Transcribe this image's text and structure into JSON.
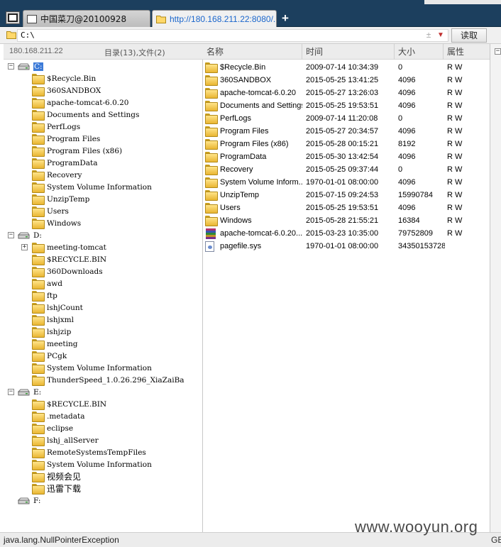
{
  "tabs": [
    {
      "label": "中国菜刀@20100928",
      "active": false
    },
    {
      "label": "http://180.168.211.22:8080/...",
      "active": true
    }
  ],
  "tab_add_label": "+",
  "address": {
    "value": "C:\\",
    "dropdown_dash": "±",
    "read_button": "读取"
  },
  "left": {
    "ip": "180.168.211.22",
    "stats": "目录(13),文件(2)"
  },
  "tree": [
    {
      "label": "C:",
      "kind": "drive",
      "selected": true,
      "expander": "−",
      "children": [
        "$Recycle.Bin",
        "360SANDBOX",
        "apache-tomcat-6.0.20",
        "Documents and Settings",
        "PerfLogs",
        "Program Files",
        "Program Files (x86)",
        "ProgramData",
        "Recovery",
        "System Volume Information",
        "UnzipTemp",
        "Users",
        "Windows"
      ]
    },
    {
      "label": "D:",
      "kind": "drive",
      "selected": false,
      "expander": "−",
      "children": [
        "meeting-tomcat",
        "$RECYCLE.BIN",
        "360Downloads",
        "awd",
        "ftp",
        "lshjCount",
        "lshjxml",
        "lshjzip",
        "meeting",
        "PCgk",
        "System Volume Information",
        "ThunderSpeed_1.0.26.296_XiaZaiBa"
      ],
      "expandable_child": "meeting-tomcat",
      "child_expander": "+"
    },
    {
      "label": "E:",
      "kind": "drive",
      "selected": false,
      "expander": "−",
      "children": [
        "$RECYCLE.BIN",
        ".metadata",
        "eclipse",
        "lshj_allServer",
        "RemoteSystemsTempFiles",
        "System Volume Information",
        "视频会见",
        "迅雷下载"
      ]
    },
    {
      "label": "F:",
      "kind": "drive",
      "selected": false,
      "children": []
    }
  ],
  "columns": {
    "name": "名称",
    "time": "时间",
    "size": "大小",
    "attr": "属性"
  },
  "files": [
    {
      "name": "$Recycle.Bin",
      "time": "2009-07-14 10:34:39",
      "size": "0",
      "attr": "R W",
      "icon": "folder-icon"
    },
    {
      "name": "360SANDBOX",
      "time": "2015-05-25 13:41:25",
      "size": "4096",
      "attr": "R W",
      "icon": "folder-icon"
    },
    {
      "name": "apache-tomcat-6.0.20",
      "time": "2015-05-27 13:26:03",
      "size": "4096",
      "attr": "R W",
      "icon": "folder-icon"
    },
    {
      "name": "Documents and Settings",
      "time": "2015-05-25 19:53:51",
      "size": "4096",
      "attr": "R W",
      "icon": "folder-icon"
    },
    {
      "name": "PerfLogs",
      "time": "2009-07-14 11:20:08",
      "size": "0",
      "attr": "R W",
      "icon": "folder-icon"
    },
    {
      "name": "Program Files",
      "time": "2015-05-27 20:34:57",
      "size": "4096",
      "attr": "R W",
      "icon": "folder-icon"
    },
    {
      "name": "Program Files (x86)",
      "time": "2015-05-28 00:15:21",
      "size": "8192",
      "attr": "R W",
      "icon": "folder-icon"
    },
    {
      "name": "ProgramData",
      "time": "2015-05-30 13:42:54",
      "size": "4096",
      "attr": "R W",
      "icon": "folder-icon"
    },
    {
      "name": "Recovery",
      "time": "2015-05-25 09:37:44",
      "size": "0",
      "attr": "R W",
      "icon": "folder-icon"
    },
    {
      "name": "System Volume Inform...",
      "time": "1970-01-01 08:00:00",
      "size": "4096",
      "attr": "R W",
      "icon": "folder-icon"
    },
    {
      "name": "UnzipTemp",
      "time": "2015-07-15 09:24:53",
      "size": "15990784",
      "attr": "R W",
      "icon": "folder-icon"
    },
    {
      "name": "Users",
      "time": "2015-05-25 19:53:51",
      "size": "4096",
      "attr": "R W",
      "icon": "folder-icon"
    },
    {
      "name": "Windows",
      "time": "2015-05-28 21:55:21",
      "size": "16384",
      "attr": "R W",
      "icon": "folder-icon"
    },
    {
      "name": "apache-tomcat-6.0.20....",
      "time": "2015-03-23 10:35:00",
      "size": "79752809",
      "attr": "R W",
      "icon": "archive-icon"
    },
    {
      "name": "pagefile.sys",
      "time": "1970-01-01 08:00:00",
      "size": "34350153728",
      "attr": "",
      "icon": "system-file-icon"
    }
  ],
  "rightstrip_expander": "−",
  "status": {
    "text": "java.lang.NullPointerException",
    "right": "GE"
  },
  "watermark": "www.wooyun.org"
}
